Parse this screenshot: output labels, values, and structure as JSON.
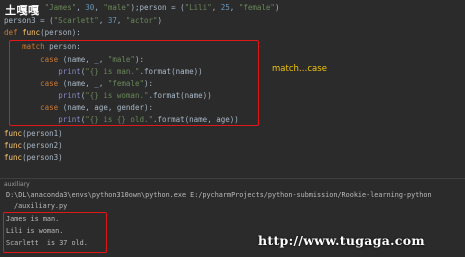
{
  "watermark_top": "土嘎嘎",
  "watermark_bottom": "http://www.tugaga.com",
  "annotation": "match…case",
  "editor": {
    "lines": [
      "         \"James\", 30, \"male\");person = (\"Lili\", 25, \"female\")",
      "person3 = (\"Scarlett\", 37, \"actor\")",
      "def func(person):",
      "    match person:",
      "        case (name, _, \"male\"):",
      "            print(\"{} is man.\".format(name))",
      "        case (name, _, \"female\"):",
      "            print(\"{} is woman.\".format(name))",
      "        case (name, age, gender):",
      "            print(\"{} is {} old.\".format(name, age))",
      "func(person1)",
      "func(person2)",
      "func(person3)"
    ]
  },
  "run": {
    "tab_label": "auxiliary",
    "command": "D:\\DL\\anaconda3\\envs\\python310own\\python.exe E:/pycharmProjects/python-submission/Rookie-learning-python",
    "command_cont": "/auxiliary.py",
    "output": [
      "James is man.",
      "Lili is woman.",
      "Scarlett  is 37 old."
    ]
  },
  "colors": {
    "background": "#2b2b2b",
    "highlight": "#e01818",
    "annotation": "#f2c40c",
    "keyword": "#cc7832",
    "string": "#6a8759",
    "number": "#6897bb"
  }
}
